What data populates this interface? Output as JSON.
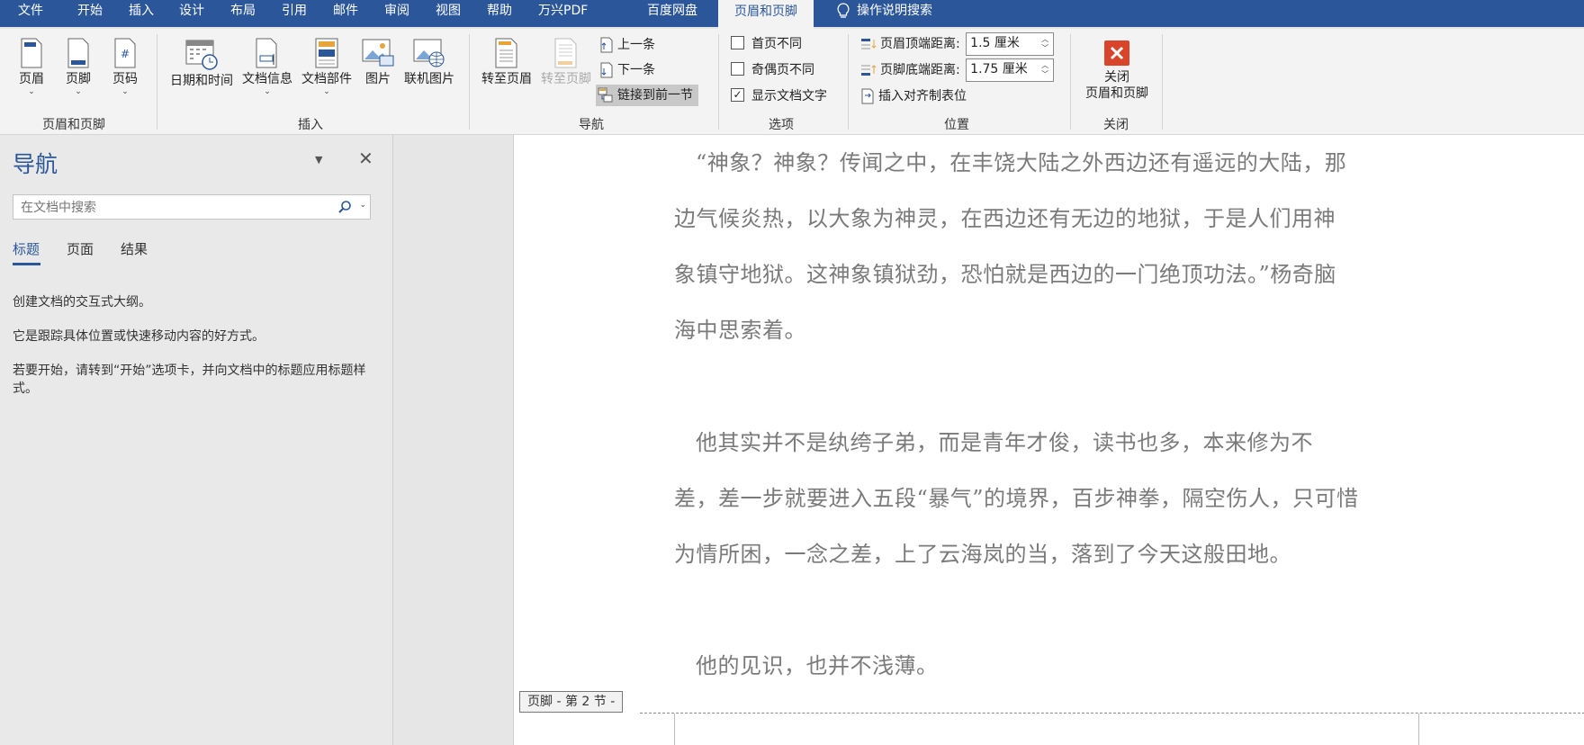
{
  "tabs": [
    "文件",
    "开始",
    "插入",
    "设计",
    "布局",
    "引用",
    "邮件",
    "审阅",
    "视图",
    "帮助",
    "万兴PDF",
    "百度网盘",
    "页眉和页脚"
  ],
  "tell_me": "操作说明搜索",
  "ribbon": {
    "header_footer": {
      "header": "页眉",
      "footer": "页脚",
      "page_number": "页码",
      "group": "页眉和页脚"
    },
    "insert": {
      "date_time": "日期和时间",
      "doc_info": "文档信息",
      "doc_parts": "文档部件",
      "picture": "图片",
      "online_picture": "联机图片",
      "group": "插入"
    },
    "navigation": {
      "goto_header": "转至页眉",
      "goto_footer": "转至页脚",
      "previous": "上一条",
      "next": "下一条",
      "link_previous": "链接到前一节",
      "group": "导航"
    },
    "options": {
      "different_first": "首页不同",
      "different_odd_even": "奇偶页不同",
      "show_doc_text": "显示文档文字",
      "group": "选项",
      "show_doc_text_checked": true
    },
    "position": {
      "header_top_label": "页眉顶端距离:",
      "header_top_value": "1.5 厘米",
      "footer_bottom_label": "页脚底端距离:",
      "footer_bottom_value": "1.75 厘米",
      "insert_align_tab": "插入对齐制表位",
      "group": "位置"
    },
    "close": {
      "label_line1": "关闭",
      "label_line2": "页眉和页脚",
      "group": "关闭"
    }
  },
  "nav_pane": {
    "title": "导航",
    "search_placeholder": "在文档中搜索",
    "tabs": [
      "标题",
      "页面",
      "结果"
    ],
    "active_tab": "标题",
    "hint1": "创建文档的交互式大纲。",
    "hint2": "它是跟踪具体位置或快速移动内容的好方式。",
    "hint3": "若要开始，请转到“开始”选项卡，并向文档中的标题应用标题样式。"
  },
  "document": {
    "p1_lines": [
      "“神象？神象？传闻之中，在丰饶大陆之外西边还有遥远的大陆，那",
      "边气候炎热，以大象为神灵，在西边还有无边的地狱，于是人们用神",
      "象镇守地狱。这神象镇狱劲，恐怕就是西边的一门绝顶功法。”杨奇脑",
      "海中思索着。"
    ],
    "p2_lines": [
      "他其实并不是纨绔子弟，而是青年才俊，读书也多，本来修为不",
      "差，差一步就要进入五段“暴气”的境界，百步神拳，隔空伤人，只可惜",
      "为情所困，一念之差，上了云海岚的当，落到了今天这般田地。"
    ],
    "p3_lines": [
      "他的见识，也并不浅薄。"
    ],
    "footer_label": "页脚 - 第 2 节 -"
  },
  "colors": {
    "accent": "#2b579a",
    "close_red": "#d9452b"
  }
}
